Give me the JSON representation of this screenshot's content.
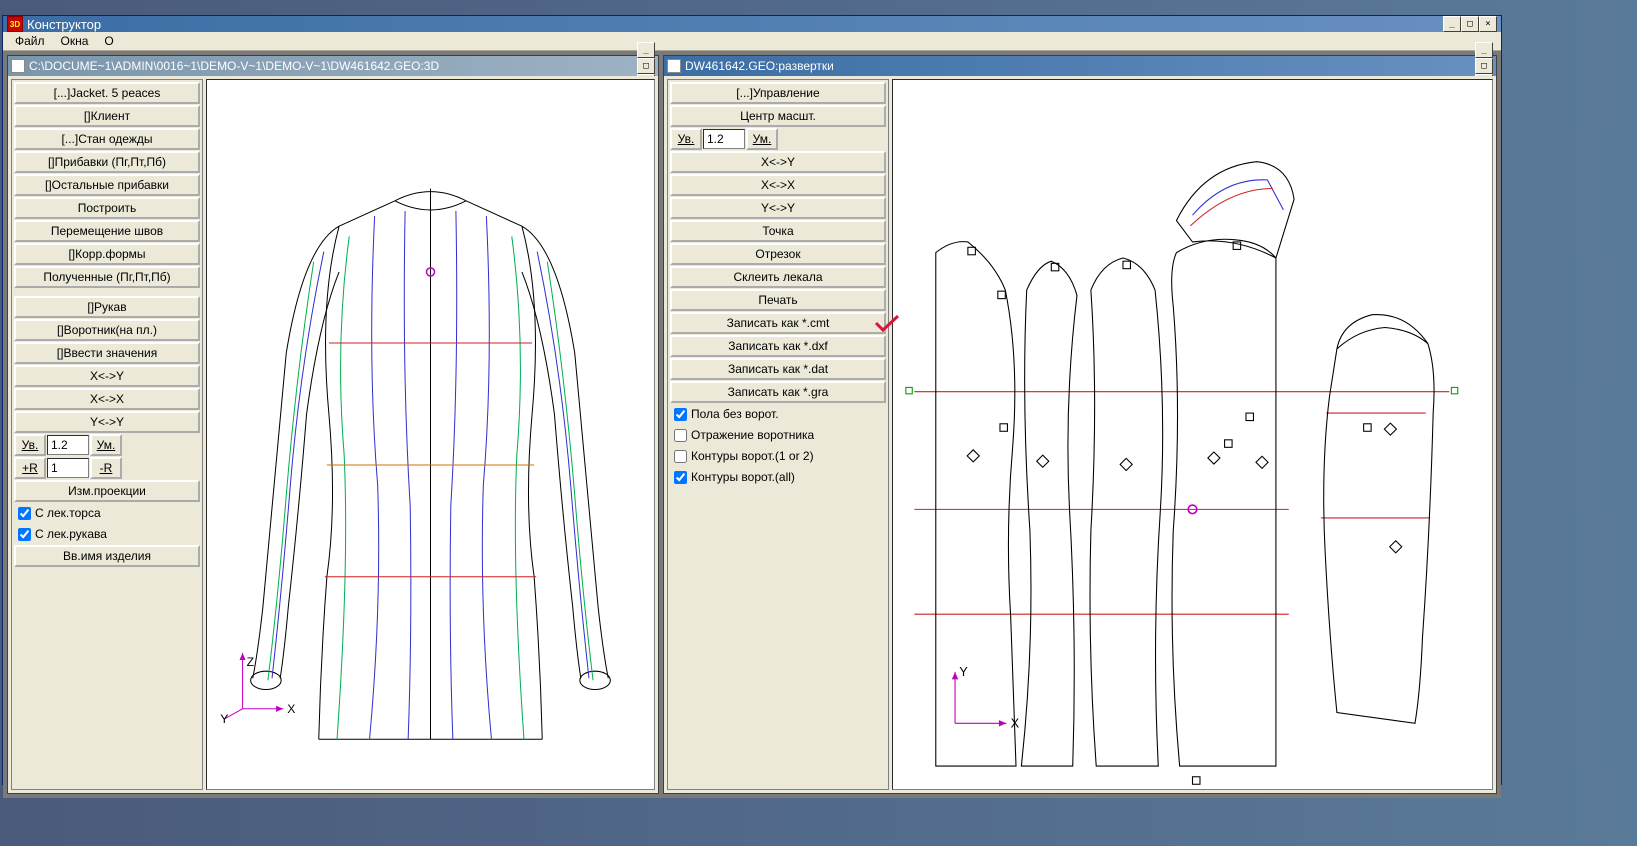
{
  "main_window": {
    "title": "Конструктор",
    "menu": {
      "file": "Файл",
      "windows": "Окна",
      "about": "О"
    }
  },
  "window_buttons": {
    "min": "_",
    "max": "□",
    "close": "×"
  },
  "left_window": {
    "title": "C:\\DOCUME~1\\ADMIN\\0016~1\\DEMO-V~1\\DEMO-V~1\\DW461642.GEO:3D",
    "panel": {
      "b1": "[...]Jacket. 5 peaces",
      "b2": "[]Клиент",
      "b3": "[...]Стан одежды",
      "b4": "[]Прибавки (Пг,Пт,Пб)",
      "b5": "[]Остальные прибавки",
      "b6": "Построить",
      "b7": "Перемещение швов",
      "b8": "[]Корр.формы",
      "b9": "Полученные (Пг,Пт,Пб)",
      "b10": "[]Рукав",
      "b11": "[]Воротник(на пл.)",
      "b12": "[]Ввести значения",
      "b13": "X<->Y",
      "b14": "X<->X",
      "b15": "Y<->Y",
      "zoom_in": "Ув.",
      "zoom_val": "1.2",
      "zoom_out": "Ум.",
      "r_plus": "+R",
      "r_val": "1",
      "r_minus": "-R",
      "b16": "Изм.проекции",
      "chk1": "С лек.торса",
      "chk2": "С лек.рукава",
      "b17": "Вв.имя изделия"
    }
  },
  "right_window": {
    "title": "DW461642.GEO:развертки",
    "panel": {
      "b1": "[...]Управление",
      "b2": "Центр масшт.",
      "zoom_in": "Ув.",
      "zoom_val": "1.2",
      "zoom_out": "Ум.",
      "b3": "X<->Y",
      "b4": "X<->X",
      "b5": "Y<->Y",
      "b6": "Точка",
      "b7": "Отрезок",
      "b8": "Склеить лекала",
      "b9": "Печать",
      "b10": "Записать как *.cmt",
      "b11": "Записать как *.dxf",
      "b12": "Записать как *.dat",
      "b13": "Записать как *.gra",
      "chk1": "Пола без ворот.",
      "chk2": "Отражение воротника",
      "chk3": "Контуры ворот.(1 or 2)",
      "chk4": "Контуры ворот.(all)"
    }
  },
  "checkbox_states": {
    "left_chk1": true,
    "left_chk2": true,
    "right_chk1": true,
    "right_chk2": false,
    "right_chk3": false,
    "right_chk4": true
  },
  "axis": {
    "x": "X",
    "y": "Y",
    "z": "Z"
  }
}
